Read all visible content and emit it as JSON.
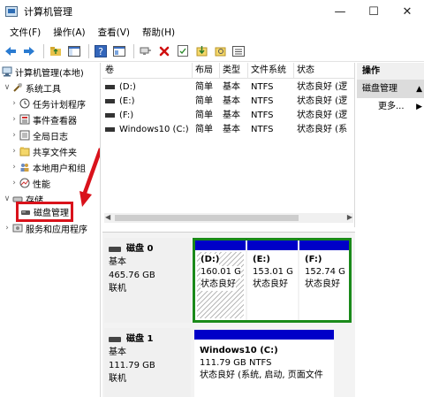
{
  "window": {
    "title": "计算机管理",
    "minimize": "—",
    "maximize": "☐",
    "close": "✕"
  },
  "menu": [
    "文件(F)",
    "操作(A)",
    "查看(V)",
    "帮助(H)"
  ],
  "tree": {
    "root": "计算机管理(本地)",
    "system_tools": "系统工具",
    "task_scheduler": "任务计划程序",
    "event_viewer": "事件查看器",
    "shared_folders": "全局日志",
    "shares": "共享文件夹",
    "local_users": "本地用户和组",
    "performance": "性能",
    "storage": "存储",
    "disk_management": "磁盘管理",
    "services": "服务和应用程序"
  },
  "volume_list": {
    "columns": [
      "卷",
      "布局",
      "类型",
      "文件系统",
      "状态"
    ],
    "rows": [
      {
        "volume": "(D:)",
        "layout": "简单",
        "type": "基本",
        "fs": "NTFS",
        "status": "状态良好 (逻"
      },
      {
        "volume": "(E:)",
        "layout": "简单",
        "type": "基本",
        "fs": "NTFS",
        "status": "状态良好 (逻"
      },
      {
        "volume": "(F:)",
        "layout": "简单",
        "type": "基本",
        "fs": "NTFS",
        "status": "状态良好 (逻"
      },
      {
        "volume": "Windows10 (C:)",
        "layout": "简单",
        "type": "基本",
        "fs": "NTFS",
        "status": "状态良好 (系"
      }
    ]
  },
  "disks": [
    {
      "name": "磁盘 0",
      "kind": "基本",
      "size": "465.76 GB",
      "state": "联机",
      "partitions": [
        {
          "label": "(D:)",
          "size": "160.01 G",
          "status": "状态良好"
        },
        {
          "label": "(E:)",
          "size": "153.01 G",
          "status": "状态良好"
        },
        {
          "label": "(F:)",
          "size": "152.74 G",
          "status": "状态良好"
        }
      ]
    },
    {
      "name": "磁盘 1",
      "kind": "基本",
      "size": "111.79 GB",
      "state": "联机",
      "partitions": [
        {
          "label": "Windows10  (C:)",
          "size": "111.79 GB NTFS",
          "status": "状态良好 (系统, 启动, 页面文件"
        }
      ]
    }
  ],
  "actions": {
    "header": "操作",
    "section": "磁盘管理",
    "more": "更多..."
  },
  "colors": {
    "partition_bar": "#0000c8",
    "annotation_red": "#d9121b",
    "selection_green": "#1a8a1a"
  }
}
